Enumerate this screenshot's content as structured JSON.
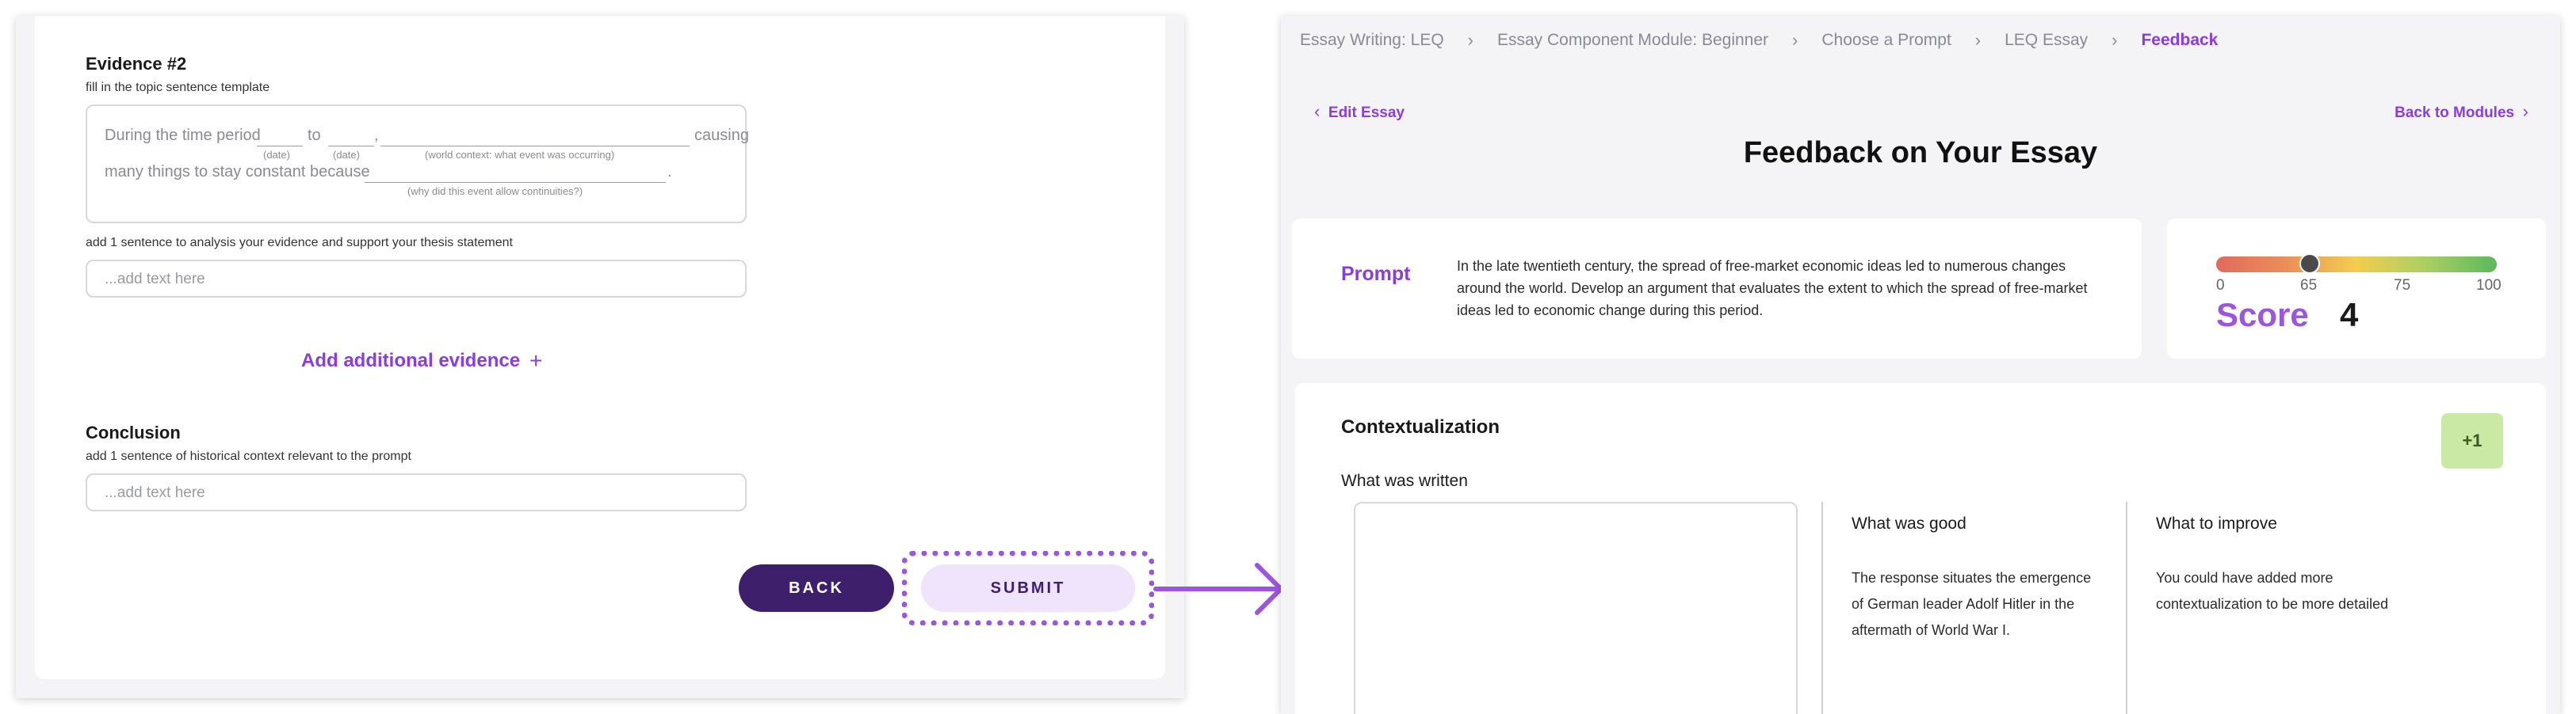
{
  "left": {
    "evidence_title": "Evidence #2",
    "evidence_subtitle": "fill in the topic sentence template",
    "template": {
      "seg1": "During the time period",
      "seg2": "to",
      "seg3": ",",
      "seg4": "causing",
      "seg5": "many things to stay constant because",
      "seg6": ".",
      "hint_date1": "(date)",
      "hint_date2": "(date)",
      "hint_context": "(world context: what event was occurring)",
      "hint_why": "(why did this event allow continuities?)"
    },
    "analysis_label": "add 1 sentence to analysis your evidence and support your thesis statement",
    "analysis_placeholder": "...add text here",
    "add_evidence_label": "Add additional evidence",
    "add_evidence_icon": "+",
    "conclusion_title": "Conclusion",
    "conclusion_subtitle": "add 1 sentence of historical context relevant to the prompt",
    "conclusion_placeholder": "...add text here",
    "back_label": "BACK",
    "submit_label": "SUBMIT"
  },
  "right": {
    "breadcrumbs": [
      "Essay Writing: LEQ",
      "Essay Component Module: Beginner",
      "Choose a Prompt",
      "LEQ Essay",
      "Feedback"
    ],
    "edit_link": "Edit Essay",
    "back_link": "Back to Modules",
    "page_title": "Feedback on Your Essay",
    "prompt_label": "Prompt",
    "prompt_text": "In the late twentieth century, the spread of free-market economic ideas led to numerous changes around the world. Develop an argument that evaluates the extent to which the spread of free-market ideas led to economic change during this period.",
    "score": {
      "ticks": [
        "0",
        "65",
        "75",
        "100"
      ],
      "knob_value": 65,
      "label": "Score",
      "value": "4"
    },
    "contextualization": {
      "title": "Contextualization",
      "badge": "+1",
      "written_label": "What was written",
      "good_label": "What was good",
      "good_text": "The response situates the emergence of German leader Adolf Hitler in the aftermath of World War I.",
      "improve_label": "What to improve",
      "improve_text": "You could have added more contextualization to be more detailed"
    }
  },
  "colors": {
    "accent_purple": "#8a3ce0",
    "back_button": "#3e1f6b",
    "submit_button": "#efe4fb",
    "badge_green": "#c9e9a4"
  }
}
